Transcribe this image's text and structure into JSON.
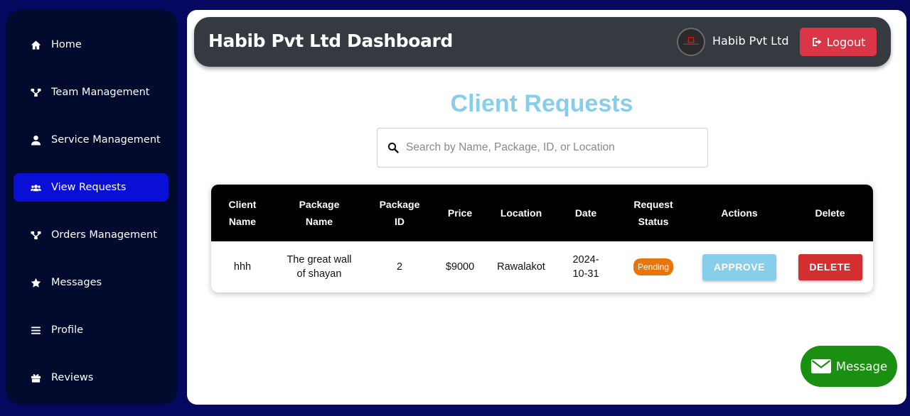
{
  "sidebar": {
    "items": [
      {
        "label": "Home",
        "icon": "home-icon",
        "active": false
      },
      {
        "label": "Team Management",
        "icon": "network-icon",
        "active": false
      },
      {
        "label": "Service Management",
        "icon": "user-icon",
        "active": false
      },
      {
        "label": "View Requests",
        "icon": "users-icon",
        "active": true
      },
      {
        "label": "Orders Management",
        "icon": "network-icon",
        "active": false
      },
      {
        "label": "Messages",
        "icon": "star-icon",
        "active": false
      },
      {
        "label": "Profile",
        "icon": "bars-icon",
        "active": false
      },
      {
        "label": "Reviews",
        "icon": "gift-icon",
        "active": false
      }
    ]
  },
  "header": {
    "title": "Habib Pvt Ltd Dashboard",
    "company_name": "Habib Pvt Ltd",
    "logout_label": "Logout"
  },
  "main": {
    "heading": "Client Requests",
    "search": {
      "placeholder": "Search by Name, Package, ID, or Location",
      "value": ""
    }
  },
  "table": {
    "columns": [
      "Client Name",
      "Package Name",
      "Package ID",
      "Price",
      "Location",
      "Date",
      "Request Status",
      "Actions",
      "Delete"
    ],
    "rows": [
      {
        "client_name": "hhh",
        "package_name": "The great wall of shayan",
        "package_id": "2",
        "price": "$9000",
        "location": "Rawalakot",
        "date": "2024-10-31",
        "status": "Pending",
        "action_label": "APPROVE",
        "delete_label": "DELETE"
      }
    ]
  },
  "message_button": {
    "label": "Message"
  },
  "colors": {
    "page_bg": "#06085f",
    "sidebar_bg": "#020b2e",
    "active_nav": "#0a0fd6",
    "topbar_bg": "#343a40",
    "logout": "#dc3545",
    "heading": "#87ceeb",
    "approve": "#87ceeb",
    "delete": "#d32f2f",
    "status_pending": "#e8740c",
    "message": "#1a8f12"
  }
}
